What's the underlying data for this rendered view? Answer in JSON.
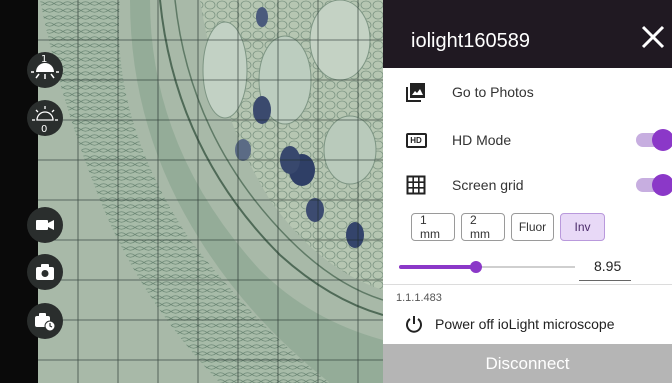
{
  "viewer": {
    "brightness_level": "1",
    "contrast_level": "0",
    "controls": [
      {
        "name": "video-record-button",
        "icon": "video-camera-icon"
      },
      {
        "name": "take-photo-button",
        "icon": "camera-icon"
      },
      {
        "name": "timelapse-button",
        "icon": "camera-timer-icon"
      }
    ]
  },
  "panel": {
    "title": "iolight160589",
    "close_icon": "close-icon",
    "go_to_photos": "Go to Photos",
    "hd_mode": {
      "label": "HD Mode",
      "icon_text": "HD",
      "enabled": true
    },
    "screen_grid": {
      "label": "Screen grid",
      "enabled": true
    },
    "chips": [
      {
        "label": "1 mm",
        "active": false
      },
      {
        "label": "2 mm",
        "active": false
      },
      {
        "label": "Fluor",
        "active": false
      },
      {
        "label": "Inv",
        "active": true
      }
    ],
    "slider": {
      "value": "8.95",
      "fraction": 0.44
    },
    "version": "1.1.1.483",
    "power_off": "Power off ioLight microscope",
    "disconnect": "Disconnect"
  },
  "colors": {
    "accent": "#8b38c8",
    "accent_light": "#c7aee0",
    "header": "#201922",
    "disconnect_bg": "#b5b5b5"
  }
}
